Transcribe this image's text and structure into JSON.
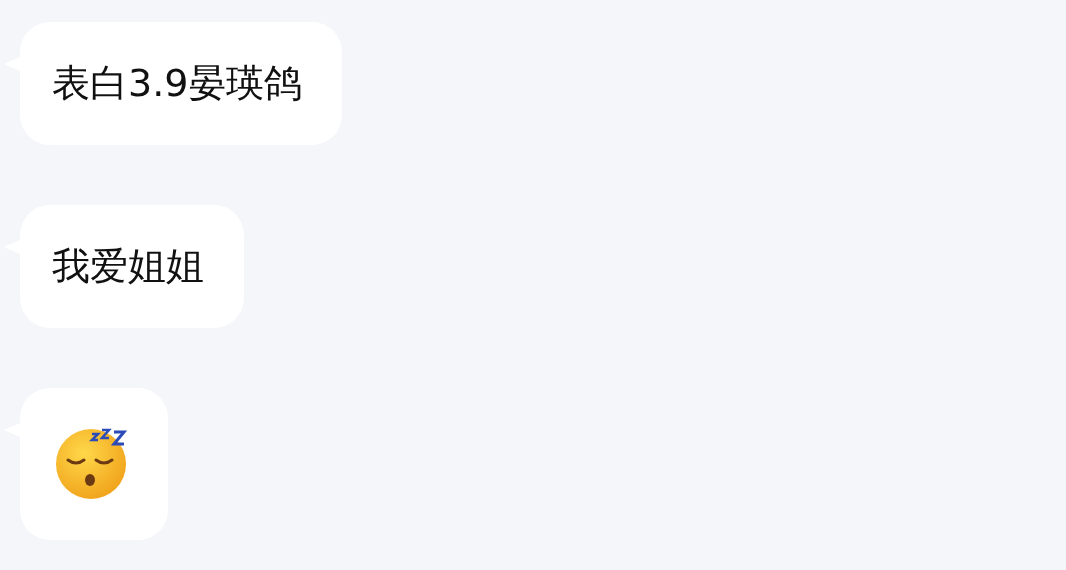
{
  "messages": [
    {
      "kind": "text",
      "text": "表白3.9晏瑛鸽"
    },
    {
      "kind": "text",
      "text": "我爱姐姐"
    },
    {
      "kind": "sticker"
    }
  ]
}
